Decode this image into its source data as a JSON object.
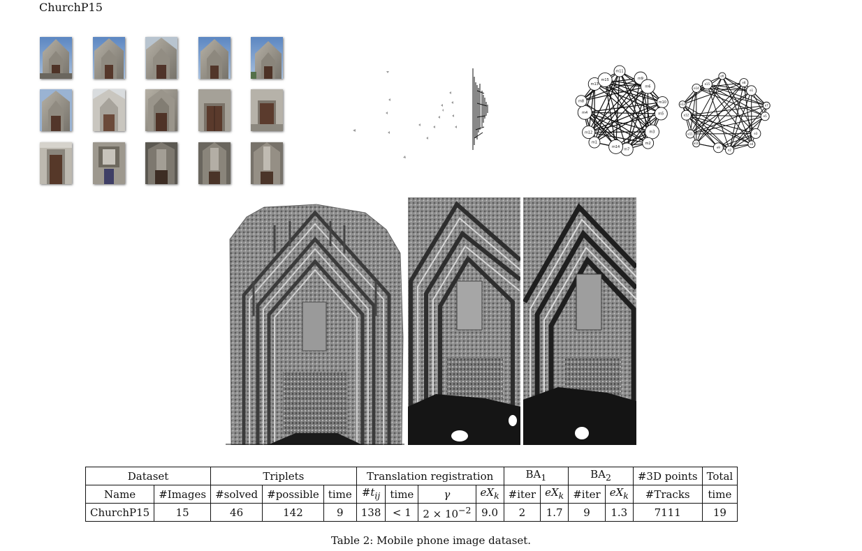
{
  "page": {
    "title": "ChurchP15"
  },
  "table": {
    "groups": [
      {
        "label": "Dataset",
        "span": 2
      },
      {
        "label": "Triplets",
        "span": 3
      },
      {
        "label": "Translation registration",
        "span": 4
      },
      {
        "label": "BA",
        "sub": "1",
        "span": 2
      },
      {
        "label": "BA",
        "sub": "2",
        "span": 2
      },
      {
        "label": "#3D points",
        "span": 1
      },
      {
        "label": "Total",
        "span": 1
      }
    ],
    "columns": [
      "Name",
      "#Images",
      "#solved",
      "#possible",
      "time",
      "#t",
      "time",
      "γ",
      "eX",
      "#iter",
      "eX",
      "#iter",
      "eX",
      "#Tracks",
      "time"
    ],
    "column_subscripts": {
      "t": "ij",
      "eX": "k"
    },
    "row": [
      "ChurchP15",
      "15",
      "46",
      "142",
      "9",
      "138",
      "< 1",
      "2 × 10",
      "9.0",
      "2",
      "1.7",
      "9",
      "1.3",
      "7111",
      "19"
    ],
    "gamma_exponent": "−2"
  },
  "caption": "Table 2: Mobile phone image dataset.",
  "graph_left_nodes": [
    "m11",
    "m9",
    "m6",
    "m10",
    "m5",
    "m3",
    "m2",
    "m7",
    "m14",
    "m1",
    "m12",
    "m4",
    "m8",
    "m13",
    "m15"
  ],
  "graph_right_nodes": [
    "e6",
    "e8",
    "e1",
    "e7",
    "e5",
    "e3",
    "e4",
    "e2",
    "e9",
    "e10",
    "e11",
    "e12",
    "e13",
    "e14",
    "e15"
  ]
}
